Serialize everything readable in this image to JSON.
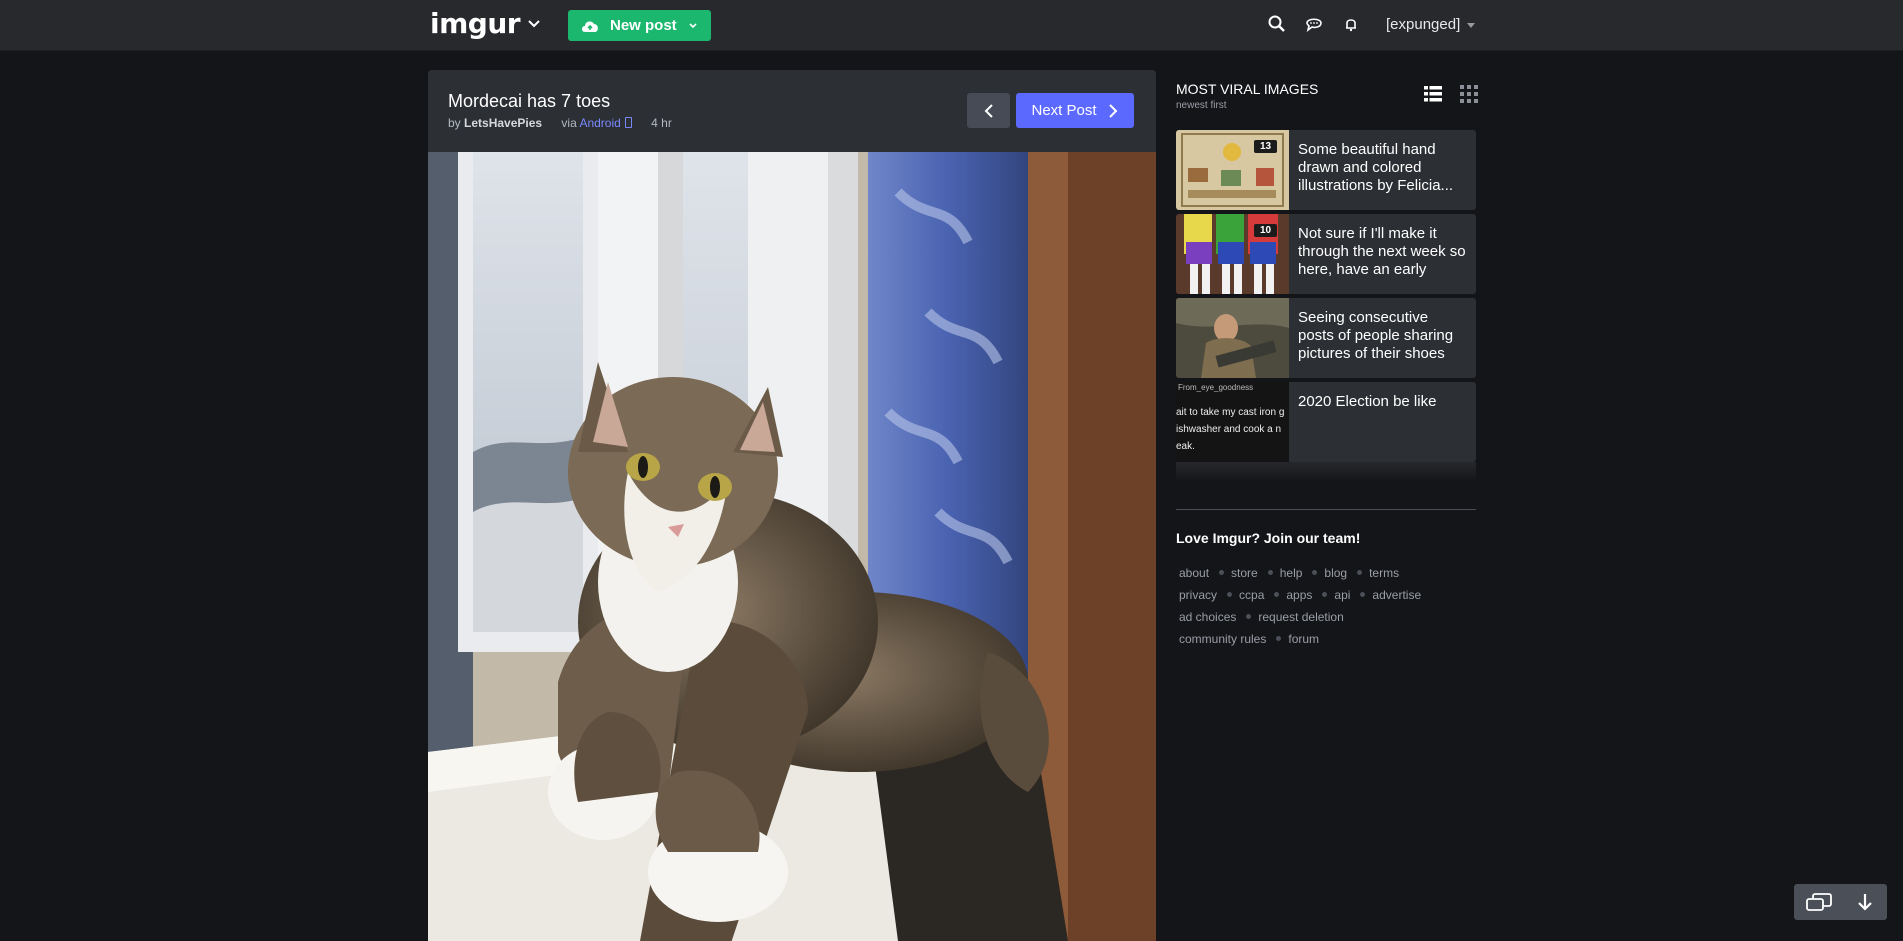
{
  "header": {
    "logo": "imgur",
    "new_post_label": "New post",
    "username": "[expunged]",
    "icons": [
      "chevron-down-icon",
      "cloud-upload-icon",
      "search-icon",
      "chat-icon",
      "bell-icon"
    ]
  },
  "post": {
    "title": "Mordecai has 7 toes",
    "by_label": "by",
    "author": "LetsHavePies",
    "via_label": "via",
    "platform": "Android",
    "time": "4 hr",
    "next_label": "Next Post"
  },
  "sidebar": {
    "title": "MOST VIRAL IMAGES",
    "subtitle": "newest first",
    "items": [
      {
        "text": "Some beautiful hand drawn and colored illustrations by Felicia...",
        "count": "13"
      },
      {
        "text": "Not sure if I'll make it through the next week so here, have an early THT...",
        "count": "10"
      },
      {
        "text": "Seeing consecutive posts of people sharing pictures of their shoes",
        "count": ""
      },
      {
        "text": "2020 Election be like",
        "count": ""
      }
    ],
    "thumb4_text": {
      "line1": "From_eye_goodness",
      "line2": "ait to take my cast iron g",
      "line3": "ishwasher and cook a n",
      "line4": "eak."
    },
    "join_text": "Love Imgur? Join our team!",
    "footer_rows": [
      [
        "about",
        "store",
        "help",
        "blog",
        "terms"
      ],
      [
        "privacy",
        "ccpa",
        "apps",
        "api",
        "advertise"
      ],
      [
        "ad choices",
        "request deletion"
      ],
      [
        "community rules",
        "forum"
      ]
    ]
  },
  "colors": {
    "accent_green": "#1bb76e",
    "accent_blue": "#5c69ff",
    "background": "#141518",
    "panel": "#2c2f34"
  }
}
